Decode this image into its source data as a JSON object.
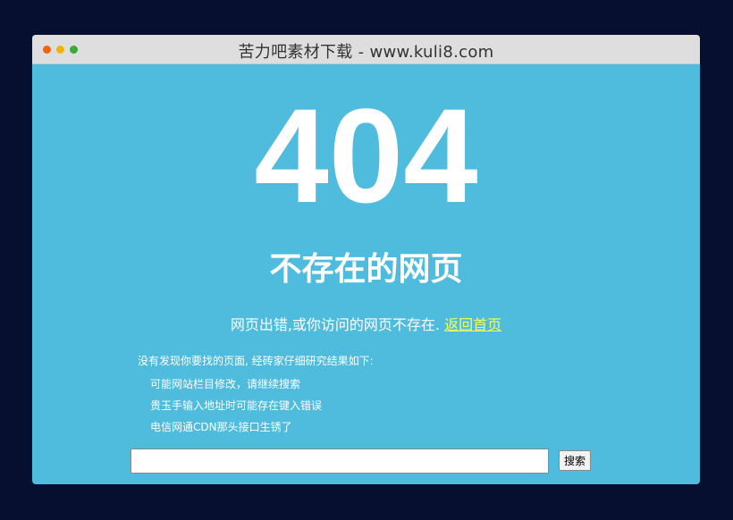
{
  "window": {
    "title": "苦力吧素材下载 - www.kuli8.com"
  },
  "error": {
    "code": "404",
    "heading": "不存在的网页",
    "message": "网页出错,或你访问的网页不存在.",
    "back_link": "返回首页"
  },
  "reasons": {
    "intro": "没有发现你要找的页面, 经砖家仔细研究结果如下:",
    "items": [
      "可能网站栏目修改，请继续搜索",
      "贵玉手输入地址时可能存在键入错误",
      "电信网通CDN那头接口生锈了"
    ]
  },
  "search": {
    "value": "",
    "placeholder": "",
    "button_label": "搜索"
  },
  "colors": {
    "background": "#070f31",
    "content": "#4fbcde",
    "titlebar": "#dedede",
    "link": "#f2ff5a"
  }
}
